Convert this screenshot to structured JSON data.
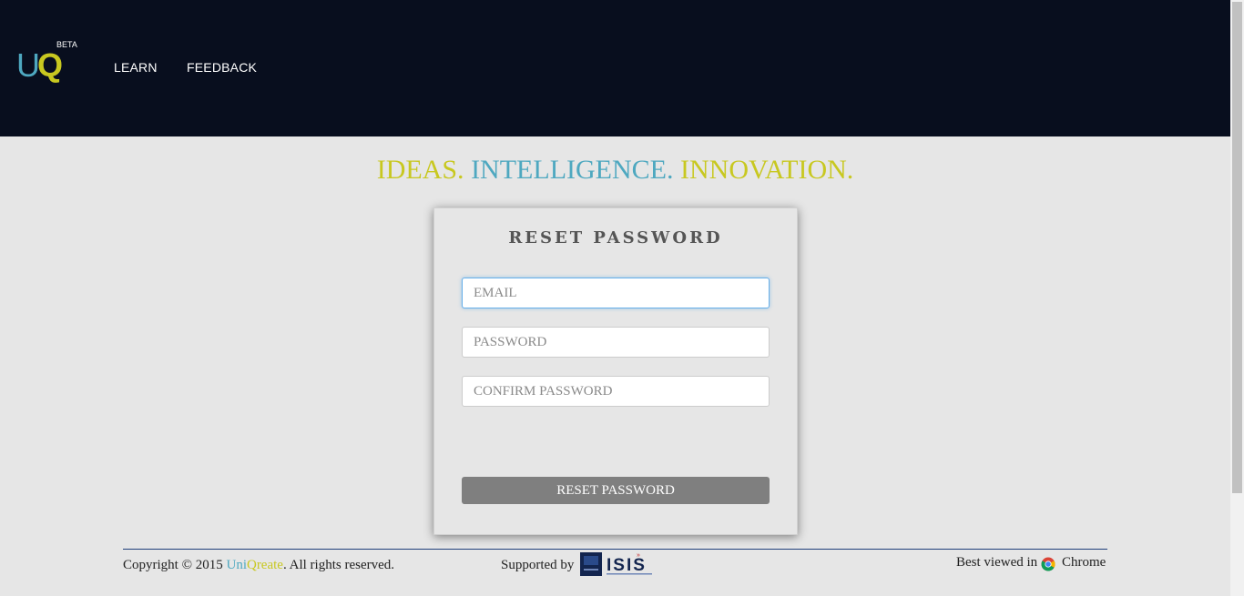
{
  "header": {
    "logo_u": "U",
    "logo_q": "Q",
    "logo_badge": "BETA",
    "nav": [
      {
        "label": "LEARN"
      },
      {
        "label": "FEEDBACK"
      }
    ]
  },
  "tagline": {
    "part1": "IDEAS.",
    "part2": "INTELLIGENCE.",
    "part3": "INNOVATION."
  },
  "form": {
    "title": "RESET PASSWORD",
    "email_placeholder": "EMAIL",
    "email_value": "",
    "password_placeholder": "PASSWORD",
    "password_value": "",
    "confirm_placeholder": "CONFIRM PASSWORD",
    "confirm_value": "",
    "submit_label": "RESET PASSWORD"
  },
  "footer": {
    "copyright_prefix": "Copyright © 2015",
    "brand_uni": "Uni",
    "brand_qreate": "Qreate",
    "copyright_suffix": ". All rights reserved.",
    "supported_by": "Supported by",
    "isis_logo_text": "ISIS",
    "best_viewed": "Best viewed in",
    "browser": "Chrome"
  },
  "colors": {
    "header_bg": "#080e1e",
    "brand_blue": "#4ea8c0",
    "brand_yellow": "#c8c820",
    "button_bg": "#7f7f7f"
  },
  "icons": {
    "browser_icon": "chrome-icon"
  }
}
